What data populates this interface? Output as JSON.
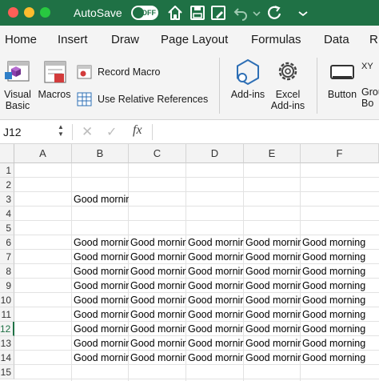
{
  "titlebar": {
    "autosave_label": "AutoSave",
    "toggle_state": "OFF",
    "icons": [
      "home-icon",
      "save-icon",
      "save-edit-icon",
      "undo-icon",
      "undo-dropdown-icon",
      "redo-icon"
    ]
  },
  "tabs": [
    "Home",
    "Insert",
    "Draw",
    "Page Layout",
    "Formulas",
    "Data",
    "R"
  ],
  "ribbon": {
    "visual_basic": "Visual\nBasic",
    "macros": "Macros",
    "record_macro": "Record Macro",
    "use_relative": "Use Relative References",
    "addins": "Add-ins",
    "excel_addins": "Excel\nAdd-ins",
    "button": "Button",
    "group_box": "Grou\nBo",
    "xy_fragment": "XY"
  },
  "formula_bar": {
    "name_box": "J12",
    "fx": "fx",
    "content": ""
  },
  "grid": {
    "columns": [
      "A",
      "B",
      "C",
      "D",
      "E",
      "F"
    ],
    "rows": [
      "1",
      "2",
      "3",
      "4",
      "5",
      "6",
      "7",
      "8",
      "9",
      "10",
      "11",
      "12",
      "13",
      "14",
      "15"
    ],
    "selected_row": "12",
    "cells": [
      {
        "row": "3",
        "col": "B",
        "text": "Good morning"
      },
      {
        "row": "6",
        "col": "B",
        "text": "Good mornin"
      },
      {
        "row": "6",
        "col": "C",
        "text": "Good mornir"
      },
      {
        "row": "6",
        "col": "D",
        "text": "Good mornir"
      },
      {
        "row": "6",
        "col": "E",
        "text": "Good mornir"
      },
      {
        "row": "6",
        "col": "F",
        "text": "Good morning"
      },
      {
        "row": "7",
        "col": "B",
        "text": "Good mornin"
      },
      {
        "row": "7",
        "col": "C",
        "text": "Good mornir"
      },
      {
        "row": "7",
        "col": "D",
        "text": "Good mornir"
      },
      {
        "row": "7",
        "col": "E",
        "text": "Good mornir"
      },
      {
        "row": "7",
        "col": "F",
        "text": "Good morning"
      },
      {
        "row": "8",
        "col": "B",
        "text": "Good mornin"
      },
      {
        "row": "8",
        "col": "C",
        "text": "Good mornir"
      },
      {
        "row": "8",
        "col": "D",
        "text": "Good mornir"
      },
      {
        "row": "8",
        "col": "E",
        "text": "Good mornir"
      },
      {
        "row": "8",
        "col": "F",
        "text": "Good morning"
      },
      {
        "row": "9",
        "col": "B",
        "text": "Good mornin"
      },
      {
        "row": "9",
        "col": "C",
        "text": "Good mornir"
      },
      {
        "row": "9",
        "col": "D",
        "text": "Good mornir"
      },
      {
        "row": "9",
        "col": "E",
        "text": "Good mornir"
      },
      {
        "row": "9",
        "col": "F",
        "text": "Good morning"
      },
      {
        "row": "10",
        "col": "B",
        "text": "Good mornin"
      },
      {
        "row": "10",
        "col": "C",
        "text": "Good mornir"
      },
      {
        "row": "10",
        "col": "D",
        "text": "Good mornir"
      },
      {
        "row": "10",
        "col": "E",
        "text": "Good mornir"
      },
      {
        "row": "10",
        "col": "F",
        "text": "Good morning"
      },
      {
        "row": "11",
        "col": "B",
        "text": "Good mornin"
      },
      {
        "row": "11",
        "col": "C",
        "text": "Good mornir"
      },
      {
        "row": "11",
        "col": "D",
        "text": "Good mornir"
      },
      {
        "row": "11",
        "col": "E",
        "text": "Good mornir"
      },
      {
        "row": "11",
        "col": "F",
        "text": "Good morning"
      },
      {
        "row": "12",
        "col": "B",
        "text": "Good mornin"
      },
      {
        "row": "12",
        "col": "C",
        "text": "Good mornir"
      },
      {
        "row": "12",
        "col": "D",
        "text": "Good mornir"
      },
      {
        "row": "12",
        "col": "E",
        "text": "Good mornir"
      },
      {
        "row": "12",
        "col": "F",
        "text": "Good morning"
      },
      {
        "row": "13",
        "col": "B",
        "text": "Good mornin"
      },
      {
        "row": "13",
        "col": "C",
        "text": "Good mornir"
      },
      {
        "row": "13",
        "col": "D",
        "text": "Good mornir"
      },
      {
        "row": "13",
        "col": "E",
        "text": "Good mornir"
      },
      {
        "row": "13",
        "col": "F",
        "text": "Good morning"
      },
      {
        "row": "14",
        "col": "B",
        "text": "Good mornin"
      },
      {
        "row": "14",
        "col": "C",
        "text": "Good mornir"
      },
      {
        "row": "14",
        "col": "D",
        "text": "Good mornir"
      },
      {
        "row": "14",
        "col": "E",
        "text": "Good mornir"
      },
      {
        "row": "14",
        "col": "F",
        "text": "Good morning"
      }
    ]
  },
  "colors": {
    "titlebar": "#1f7145",
    "ribbon": "#f4f4f4",
    "header_bg": "#f3f3f3",
    "gridline": "#e2e2e2",
    "selected_row_accent": "#1f7145"
  }
}
